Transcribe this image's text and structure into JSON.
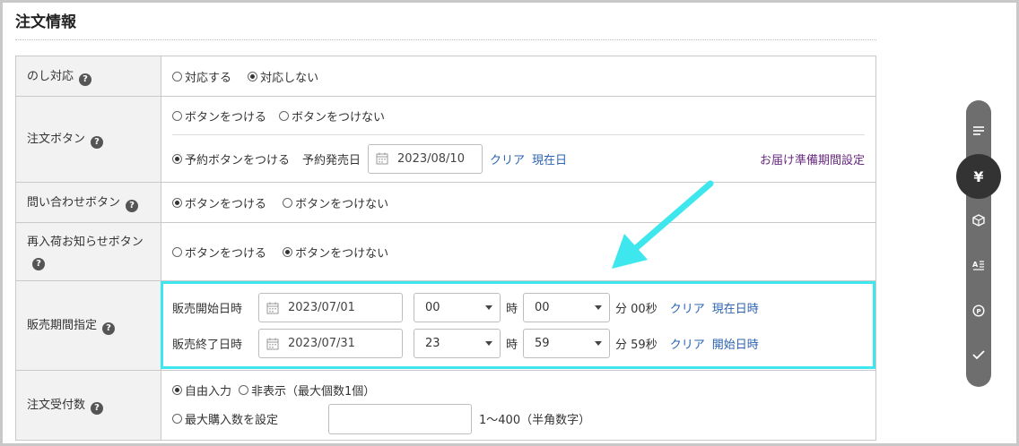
{
  "section_title": "注文情報",
  "rows": {
    "noshi": {
      "label": "のし対応",
      "options": [
        "対応する",
        "対応しない"
      ]
    },
    "order_button": {
      "label": "注文ボタン",
      "options": [
        "ボタンをつける",
        "ボタンをつけない"
      ],
      "reserve_option": "予約ボタンをつける",
      "release_label": "予約発売日",
      "release_date": "2023/08/10",
      "clear": "クリア",
      "today": "現在日",
      "delivery_link": "お届け準備期間設定"
    },
    "inquiry": {
      "label": "問い合わせボタン",
      "options": [
        "ボタンをつける",
        "ボタンをつけない"
      ]
    },
    "restock": {
      "label": "再入荷お知らせボタン",
      "options": [
        "ボタンをつける",
        "ボタンをつけない"
      ]
    },
    "sale_period": {
      "label": "販売期間指定",
      "start_label": "販売開始日時",
      "start_date": "2023/07/01",
      "start_hour": "00",
      "start_minute": "00",
      "start_sec": "分 00秒",
      "end_label": "販売終了日時",
      "end_date": "2023/07/31",
      "end_hour": "23",
      "end_minute": "59",
      "end_sec": "分 59秒",
      "hour_unit": "時",
      "clear": "クリア",
      "now": "現在日時",
      "start_link": "開始日時"
    },
    "order_count": {
      "label": "注文受付数",
      "free": "自由入力",
      "hidden": "非表示（最大個数1個）",
      "max": "最大購入数を設定",
      "max_value": "",
      "range_hint": "1〜400（半角数字）"
    }
  },
  "help_glyph": "?",
  "side_active_glyph": "¥",
  "colors": {
    "highlight": "#3ee6ee",
    "arrow": "#3ee6ee",
    "link": "#2c63b0",
    "side_bar": "#6e6e6e"
  }
}
